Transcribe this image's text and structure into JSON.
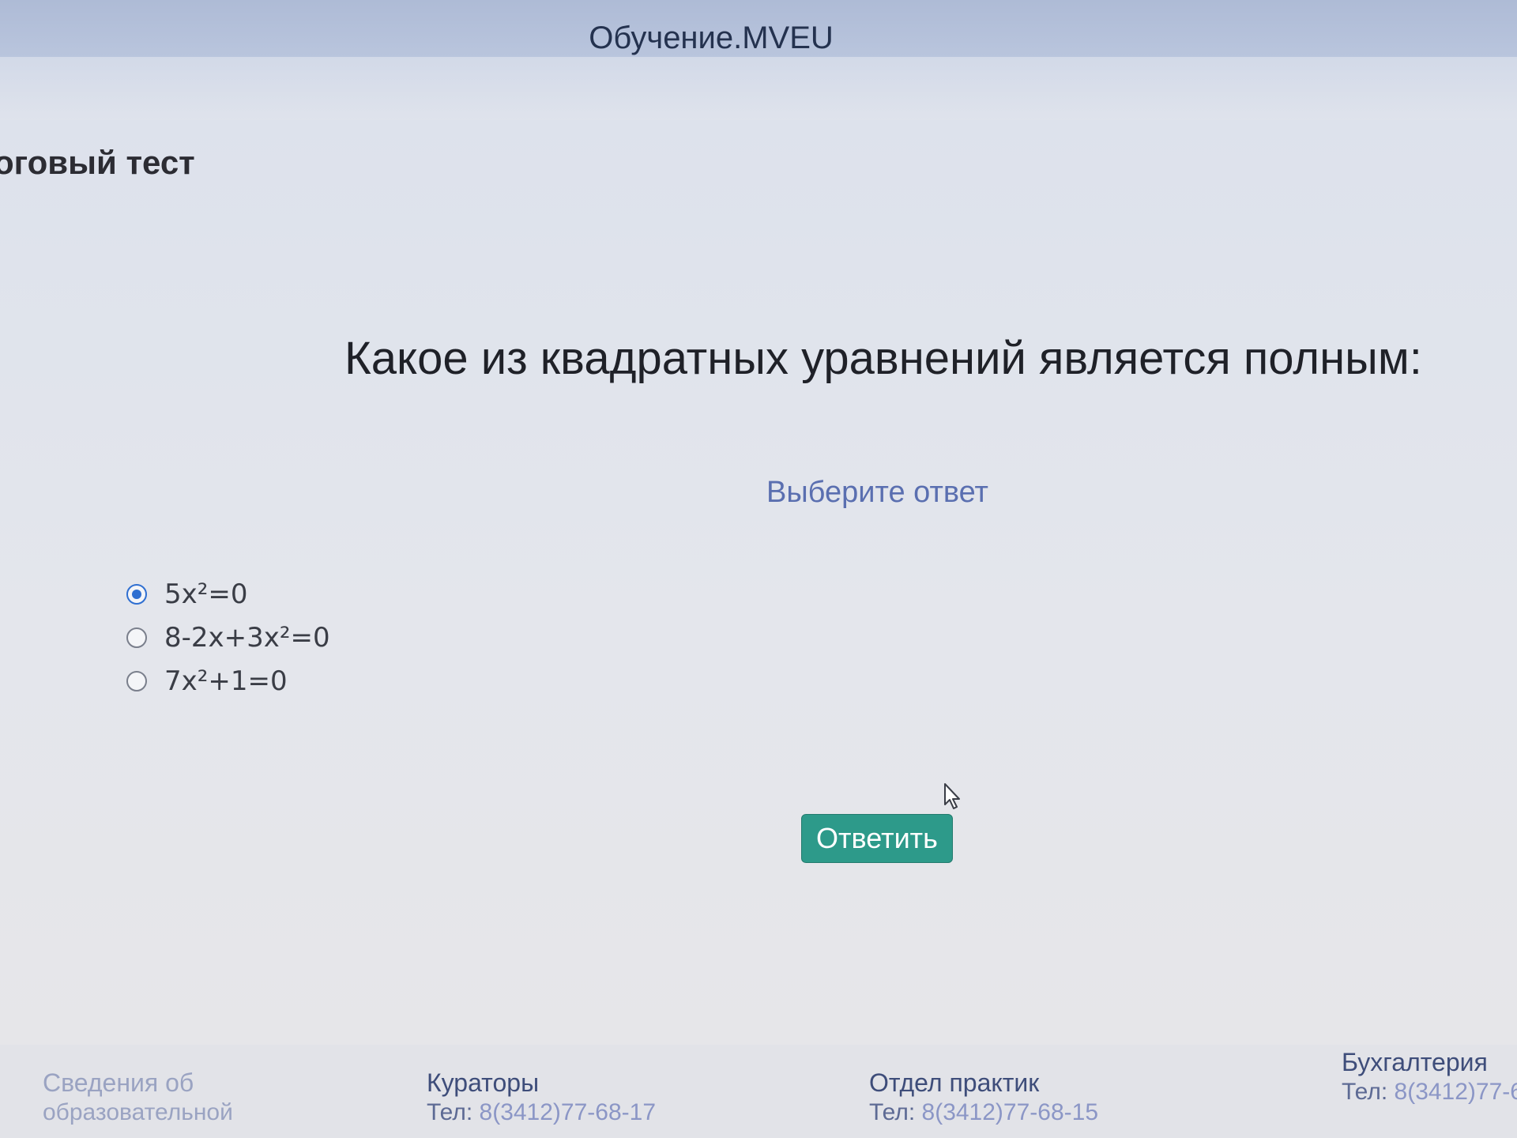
{
  "header": {
    "site_title": "Обучение.MVEU"
  },
  "page": {
    "section_title": "тоговый тест",
    "question": "Какое из квадратных уравнений является полным:",
    "hint": "Выберите ответ"
  },
  "options": [
    {
      "label": "5x²=0",
      "selected": true
    },
    {
      "label": "8-2x+3x²=0",
      "selected": false
    },
    {
      "label": "7x²+1=0",
      "selected": false
    }
  ],
  "actions": {
    "submit_label": "Ответить"
  },
  "footer": {
    "col1": {
      "line1": "Сведения об",
      "line2": "образовательной"
    },
    "col2": {
      "heading": "Кураторы",
      "phone_prefix": "Тел:",
      "phone": "8(3412)77-68-17"
    },
    "col3": {
      "heading": "Отдел практик",
      "phone_prefix": "Тел:",
      "phone": "8(3412)77-68-15"
    },
    "col4": {
      "heading": "Бухгалтерия",
      "phone_prefix": "Тел:",
      "phone": "8(3412)77-6"
    }
  },
  "colors": {
    "accent_button": "#2d9a8a",
    "link_blue": "#5a6fb0",
    "header_bg": "#aebbd6"
  }
}
